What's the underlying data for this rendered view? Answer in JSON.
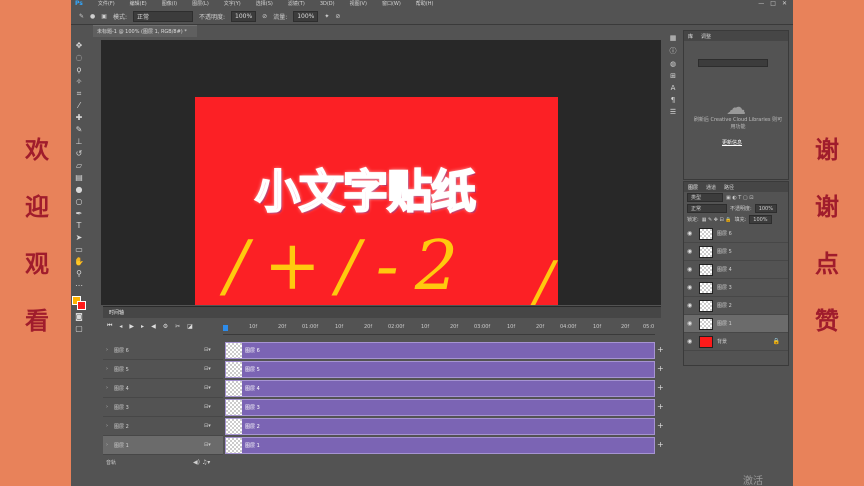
{
  "side_left": [
    "欢",
    "迎",
    "观",
    "看"
  ],
  "side_right": [
    "谢",
    "谢",
    "点",
    "赞"
  ],
  "menu": {
    "logo": "Ps",
    "items": [
      "文件(F)",
      "编辑(E)",
      "图像(I)",
      "图层(L)",
      "文字(Y)",
      "选择(S)",
      "滤镜(T)",
      "3D(D)",
      "视图(V)",
      "窗口(W)",
      "帮助(H)"
    ],
    "window_buttons": [
      "—",
      "□",
      "✕"
    ]
  },
  "options": {
    "mode_label": "模式:",
    "mode_value": "正常",
    "opacity_label": "不透明度:",
    "opacity_value": "100%",
    "flow_label": "流量:",
    "flow_value": "100%"
  },
  "document_tab": "未标题-1 @ 100% (图层 1, RGB/8#) *",
  "canvas": {
    "sticker_title": "小文字贴纸",
    "handwriting": "/+/-2",
    "handwriting_right": "/"
  },
  "libraries": {
    "tabs": [
      "库",
      "调整"
    ],
    "message": "刷新后 Creative Cloud Libraries 则可用功能",
    "refresh": "更新信息"
  },
  "layers_panel": {
    "tabs": [
      "图层",
      "通道",
      "路径"
    ],
    "kind_label": "类型",
    "blend_mode": "正常",
    "opacity_label": "不透明度:",
    "opacity_value": "100%",
    "lock_label": "锁定:",
    "fill_label": "填充:",
    "fill_value": "100%",
    "layers": [
      {
        "name": "图层 6",
        "selected": false
      },
      {
        "name": "图层 5",
        "selected": false
      },
      {
        "name": "图层 4",
        "selected": false
      },
      {
        "name": "图层 3",
        "selected": false
      },
      {
        "name": "图层 2",
        "selected": false
      },
      {
        "name": "图层 1",
        "selected": true
      },
      {
        "name": "背景",
        "selected": false
      }
    ]
  },
  "timeline": {
    "tab": "时间轴",
    "ruler_ticks": [
      "10f",
      "20f",
      "01:00f",
      "10f",
      "20f",
      "02:00f",
      "10f",
      "20f",
      "03:00f",
      "10f",
      "20f",
      "04:00f",
      "10f",
      "20f",
      "05:0"
    ],
    "tracks": [
      {
        "name": "图层 6",
        "clip": "图层 6",
        "selected": false
      },
      {
        "name": "图层 5",
        "clip": "图层 5",
        "selected": false
      },
      {
        "name": "图层 4",
        "clip": "图层 4",
        "selected": false
      },
      {
        "name": "图层 3",
        "clip": "图层 3",
        "selected": false
      },
      {
        "name": "图层 2",
        "clip": "图层 2",
        "selected": false
      },
      {
        "name": "图层 1",
        "clip": "图层 1",
        "selected": true
      }
    ],
    "audio_track": "音轨"
  },
  "watermark": "激活 Windows"
}
